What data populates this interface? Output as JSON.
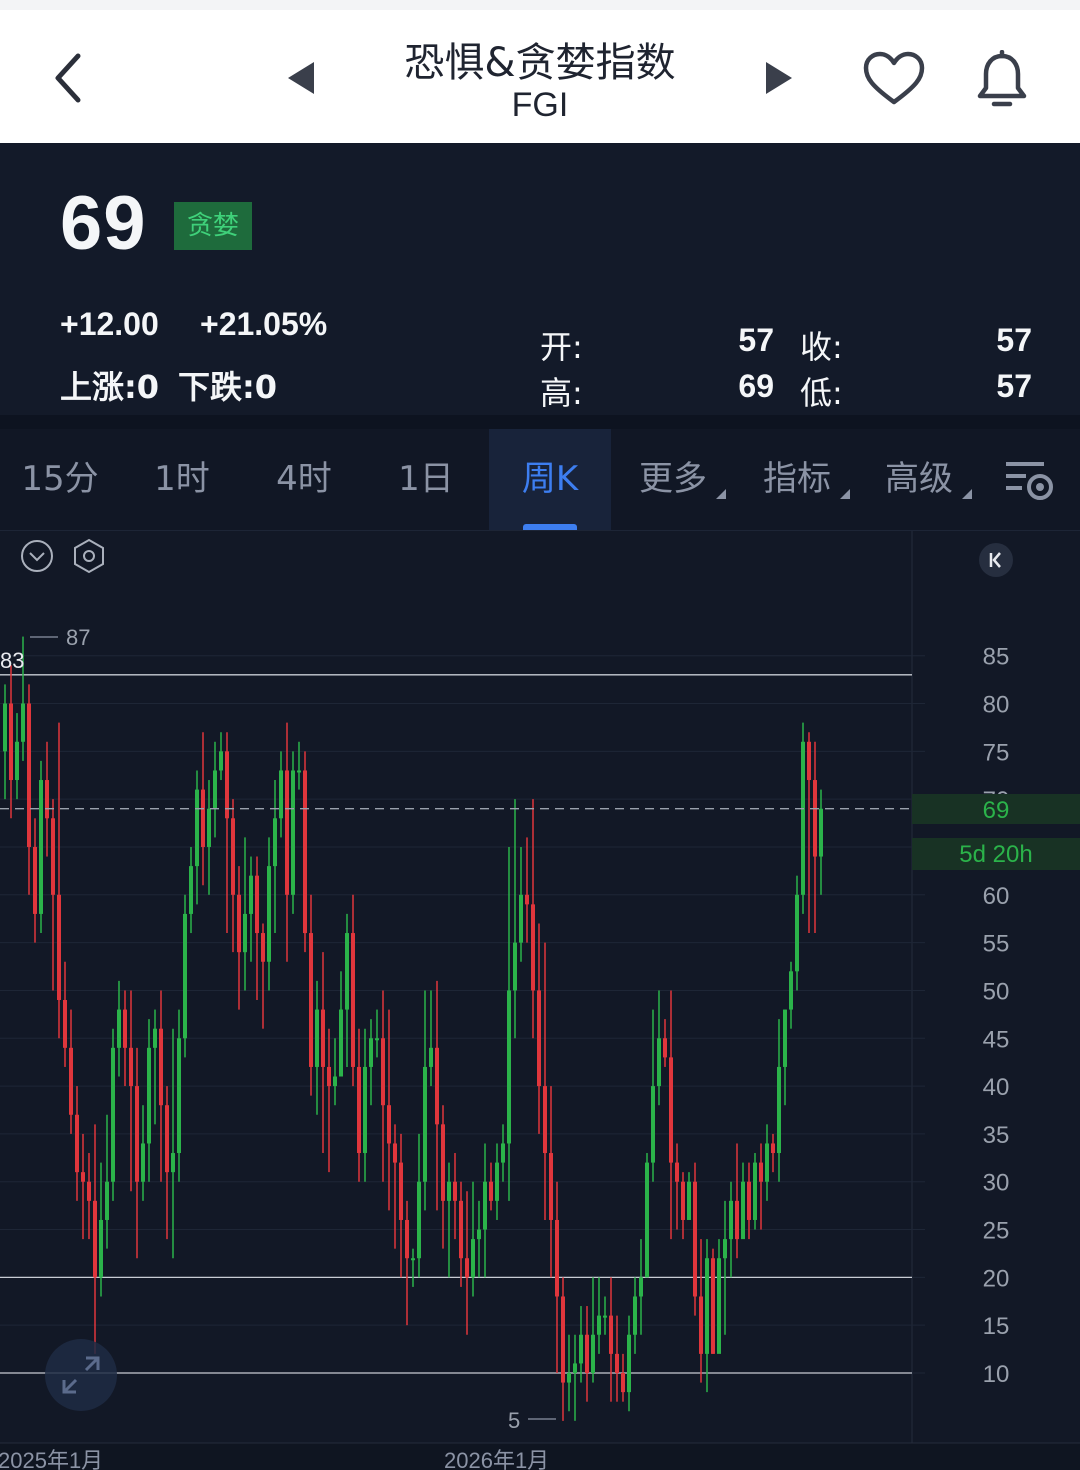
{
  "header": {
    "title": "恐惧&贪婪指数",
    "subtitle": "FGI",
    "icons": [
      "back-icon",
      "prev-icon",
      "next-icon",
      "heart-icon",
      "bell-icon"
    ]
  },
  "quote": {
    "price": "69",
    "badge": "贪婪",
    "change": "+12.00",
    "change_pct": "+21.05%",
    "up_label": "上涨:0",
    "down_label": "下跌:0",
    "open_label": "开:",
    "open": "57",
    "close_label": "收:",
    "close": "57",
    "high_label": "高:",
    "high": "69",
    "low_label": "低:",
    "low": "57"
  },
  "tabs": [
    {
      "label": "15分"
    },
    {
      "label": "1时"
    },
    {
      "label": "4时"
    },
    {
      "label": "1日"
    },
    {
      "label": "周K"
    },
    {
      "label": "更多"
    },
    {
      "label": "指标"
    },
    {
      "label": "高级"
    }
  ],
  "colors": {
    "up": "#2bb34a",
    "down": "#e0363c",
    "accent": "#3d7ef0",
    "current": "#2bb34a"
  },
  "chart_data": {
    "type": "candlestick",
    "y_ticks": [
      "85",
      "80",
      "75",
      "70",
      "69",
      "5d 20h",
      "60",
      "55",
      "50",
      "45",
      "40",
      "35",
      "30",
      "25",
      "20",
      "15",
      "10"
    ],
    "x_labels": [
      "2025年1月",
      "2026年1月"
    ],
    "max_label": "87",
    "min_label": "5",
    "left_level_label": "83",
    "current_value": 69,
    "current_label": "69",
    "countdown": "5d 20h",
    "candles": [
      [
        75,
        80,
        70,
        82
      ],
      [
        80,
        72,
        68,
        84
      ],
      [
        72,
        76,
        70,
        79
      ],
      [
        76,
        80,
        74,
        87
      ],
      [
        80,
        65,
        60,
        82
      ],
      [
        65,
        58,
        55,
        68
      ],
      [
        58,
        72,
        56,
        74
      ],
      [
        72,
        68,
        64,
        76
      ],
      [
        68,
        60,
        50,
        70
      ],
      [
        60,
        49,
        45,
        78
      ],
      [
        49,
        44,
        42,
        53
      ],
      [
        44,
        37,
        35,
        48
      ],
      [
        37,
        31,
        28,
        40
      ],
      [
        31,
        30,
        24,
        35
      ],
      [
        30,
        28,
        24,
        33
      ],
      [
        28,
        20,
        12,
        36
      ],
      [
        20,
        26,
        18,
        32
      ],
      [
        26,
        30,
        23,
        37
      ],
      [
        30,
        44,
        28,
        46
      ],
      [
        44,
        48,
        41,
        51
      ],
      [
        48,
        44,
        40,
        50
      ],
      [
        44,
        40,
        29,
        50
      ],
      [
        40,
        30,
        22,
        44
      ],
      [
        30,
        34,
        28,
        38
      ],
      [
        34,
        44,
        30,
        47
      ],
      [
        44,
        46,
        36,
        48
      ],
      [
        46,
        38,
        30,
        50
      ],
      [
        38,
        31,
        24,
        40
      ],
      [
        31,
        33,
        22,
        46
      ],
      [
        33,
        45,
        30,
        48
      ],
      [
        45,
        58,
        43,
        60
      ],
      [
        58,
        63,
        56,
        65
      ],
      [
        63,
        71,
        59,
        73
      ],
      [
        71,
        65,
        61,
        77
      ],
      [
        65,
        69,
        60,
        72
      ],
      [
        69,
        73,
        66,
        76
      ],
      [
        73,
        75,
        72,
        77
      ],
      [
        75,
        68,
        56,
        77
      ],
      [
        68,
        60,
        54,
        70
      ],
      [
        60,
        54,
        48,
        63
      ],
      [
        54,
        58,
        50,
        66
      ],
      [
        58,
        62,
        53,
        64
      ],
      [
        62,
        56,
        49,
        64
      ],
      [
        56,
        53,
        46,
        57
      ],
      [
        53,
        63,
        50,
        66
      ],
      [
        63,
        68,
        56,
        72
      ],
      [
        68,
        73,
        66,
        75
      ],
      [
        73,
        60,
        53,
        78
      ],
      [
        60,
        73,
        58,
        75
      ],
      [
        73,
        73,
        71,
        76
      ],
      [
        73,
        56,
        54,
        75
      ],
      [
        56,
        42,
        39,
        60
      ],
      [
        42,
        48,
        37,
        51
      ],
      [
        48,
        42,
        33,
        54
      ],
      [
        42,
        40,
        31,
        46
      ],
      [
        40,
        41,
        38,
        45
      ],
      [
        41,
        48,
        43,
        52
      ],
      [
        48,
        56,
        42,
        58
      ],
      [
        56,
        42,
        40,
        60
      ],
      [
        42,
        33,
        30,
        46
      ],
      [
        33,
        42,
        30,
        46
      ],
      [
        42,
        45,
        38,
        47
      ],
      [
        45,
        45,
        43,
        48
      ],
      [
        45,
        38,
        30,
        50
      ],
      [
        38,
        34,
        27,
        48
      ],
      [
        34,
        32,
        23,
        36
      ],
      [
        32,
        26,
        20,
        35
      ],
      [
        26,
        22,
        15,
        28
      ],
      [
        22,
        22,
        19,
        23
      ],
      [
        22,
        30,
        20,
        35
      ],
      [
        30,
        42,
        27,
        50
      ],
      [
        42,
        44,
        40,
        50
      ],
      [
        44,
        36,
        27,
        51
      ],
      [
        36,
        28,
        23,
        38
      ],
      [
        28,
        30,
        20,
        32
      ],
      [
        30,
        28,
        24,
        33
      ],
      [
        28,
        22,
        19,
        30
      ],
      [
        22,
        20,
        14,
        29
      ],
      [
        20,
        24,
        18,
        30
      ],
      [
        24,
        25,
        20,
        28
      ],
      [
        25,
        30,
        20,
        34
      ],
      [
        30,
        28,
        27,
        32
      ],
      [
        28,
        32,
        26,
        34
      ],
      [
        32,
        34,
        30,
        36
      ],
      [
        34,
        50,
        28,
        65
      ],
      [
        50,
        55,
        45,
        70
      ],
      [
        55,
        60,
        53,
        65
      ],
      [
        60,
        59,
        55,
        66
      ],
      [
        59,
        50,
        45,
        70
      ],
      [
        50,
        40,
        35,
        57
      ],
      [
        40,
        33,
        26,
        55
      ],
      [
        33,
        26,
        20,
        40
      ],
      [
        26,
        18,
        10,
        30
      ],
      [
        18,
        9,
        5,
        20
      ],
      [
        9,
        10,
        6,
        14
      ],
      [
        10,
        11,
        5,
        14
      ],
      [
        11,
        14,
        9,
        17
      ],
      [
        14,
        10,
        7,
        17
      ],
      [
        10,
        14,
        9,
        20
      ],
      [
        14,
        16,
        12,
        20
      ],
      [
        16,
        16,
        14,
        18
      ],
      [
        16,
        12,
        7,
        20
      ],
      [
        12,
        10,
        7,
        16
      ],
      [
        10,
        8,
        7,
        12
      ],
      [
        8,
        14,
        6,
        16
      ],
      [
        14,
        18,
        12,
        20
      ],
      [
        18,
        20,
        14,
        24
      ],
      [
        20,
        32,
        20,
        33
      ],
      [
        32,
        40,
        30,
        48
      ],
      [
        40,
        45,
        38,
        50
      ],
      [
        45,
        43,
        42,
        47
      ],
      [
        43,
        32,
        24,
        50
      ],
      [
        32,
        30,
        25,
        34
      ],
      [
        30,
        26,
        24,
        31
      ],
      [
        26,
        30,
        28,
        31
      ],
      [
        30,
        18,
        16,
        32
      ],
      [
        18,
        12,
        9,
        24
      ],
      [
        12,
        22,
        8,
        24
      ],
      [
        22,
        12,
        12,
        23
      ],
      [
        12,
        22,
        16,
        24
      ],
      [
        22,
        24,
        14,
        28
      ],
      [
        24,
        28,
        20,
        30
      ],
      [
        28,
        24,
        22,
        34
      ],
      [
        24,
        30,
        28,
        32
      ],
      [
        30,
        26,
        24,
        32
      ],
      [
        26,
        32,
        25,
        33
      ],
      [
        32,
        30,
        25,
        34
      ],
      [
        30,
        34,
        28,
        36
      ],
      [
        34,
        33,
        31,
        35
      ],
      [
        33,
        42,
        30,
        47
      ],
      [
        42,
        48,
        38,
        48
      ],
      [
        48,
        52,
        46,
        53
      ],
      [
        52,
        60,
        50,
        62
      ],
      [
        60,
        76,
        58,
        78
      ],
      [
        76,
        72,
        56,
        77
      ],
      [
        72,
        64,
        56,
        76
      ],
      [
        64,
        69,
        60,
        71
      ]
    ]
  }
}
